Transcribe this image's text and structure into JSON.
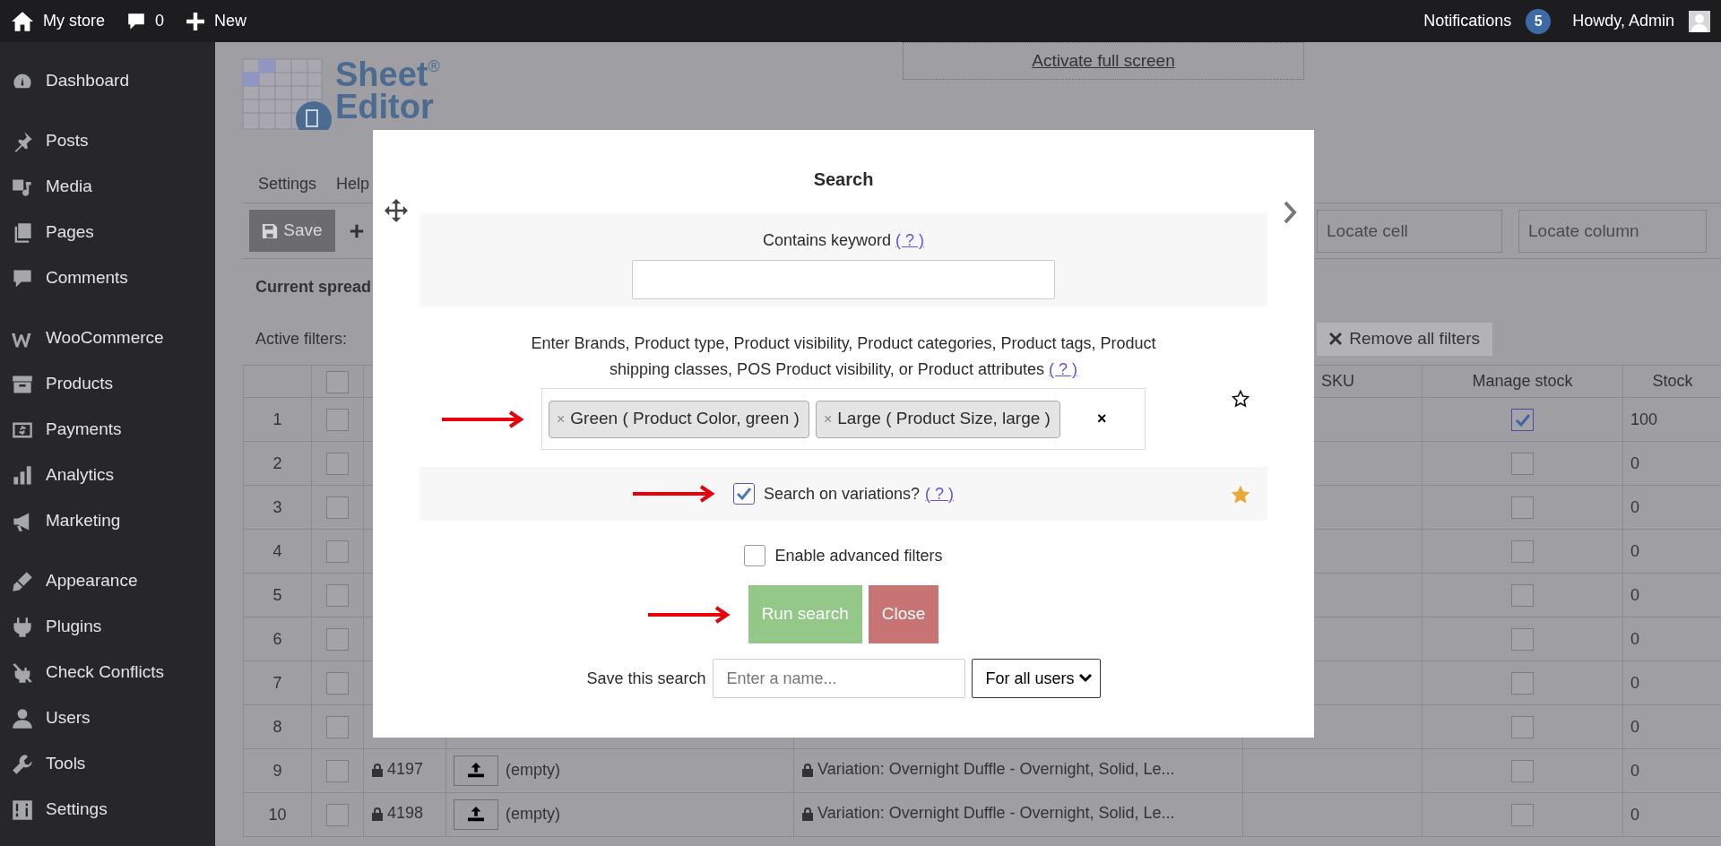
{
  "top_bar": {
    "site": "My store",
    "comments": "0",
    "new": "New",
    "notifications": "Notifications",
    "notifications_count": "5",
    "greeting": "Howdy, Admin"
  },
  "sidebar": {
    "groups": [
      {
        "items": [
          {
            "label": "Dashboard"
          }
        ]
      },
      {
        "items": [
          {
            "label": "Posts"
          },
          {
            "label": "Media"
          },
          {
            "label": "Pages"
          },
          {
            "label": "Comments"
          }
        ]
      },
      {
        "items": [
          {
            "label": "WooCommerce"
          },
          {
            "label": "Products"
          },
          {
            "label": "Payments"
          },
          {
            "label": "Analytics"
          },
          {
            "label": "Marketing"
          }
        ]
      },
      {
        "items": [
          {
            "label": "Appearance"
          },
          {
            "label": "Plugins"
          },
          {
            "label": "Check Conflicts"
          },
          {
            "label": "Users"
          },
          {
            "label": "Tools"
          },
          {
            "label": "Settings"
          }
        ]
      }
    ]
  },
  "editor": {
    "logo": {
      "line_1": "Sheet",
      "line_2": "Editor",
      "mark": "®"
    },
    "fullscreen_link": "Activate full screen",
    "menu": [
      "Settings",
      "Help"
    ],
    "toolbar": {
      "save": "Save",
      "locate_cell_placeholder": "Locate cell",
      "locate_column_placeholder": "Locate column"
    },
    "heading": "Current spread",
    "active_filters_label": "Active filters:",
    "remove_filters": "Remove all filters",
    "table": {
      "header_checkbox": {
        "checked": false
      },
      "columns": [
        "SKU",
        "Manage stock",
        "Stock"
      ],
      "rows": [
        {
          "number": "1",
          "checked": false,
          "manage_stock": true,
          "stock": "100"
        },
        {
          "number": "2",
          "checked": false,
          "manage_stock": false,
          "stock": "0"
        },
        {
          "number": "3",
          "checked": false,
          "manage_stock": false,
          "stock": "0"
        },
        {
          "number": "4",
          "checked": false,
          "manage_stock": false,
          "stock": "0"
        },
        {
          "number": "5",
          "checked": false,
          "manage_stock": false,
          "stock": "0"
        },
        {
          "number": "6",
          "checked": false,
          "manage_stock": false,
          "stock": "0"
        },
        {
          "number": "7",
          "checked": false,
          "manage_stock": false,
          "stock": "0"
        },
        {
          "number": "8",
          "checked": false,
          "manage_stock": false,
          "stock": "0"
        },
        {
          "number": "9",
          "checked": false,
          "id": "4197",
          "image": "(empty)",
          "title": "Variation: Overnight Duffle - Overnight, Solid, Le...",
          "manage_stock": false,
          "stock": "0"
        },
        {
          "number": "10",
          "checked": false,
          "id": "4198",
          "image": "(empty)",
          "title": "Variation: Overnight Duffle - Overnight, Solid, Le...",
          "manage_stock": false,
          "stock": "0"
        }
      ]
    }
  },
  "dialog": {
    "title": "Search",
    "keyword": {
      "label": "Contains keyword",
      "help": "( ? )"
    },
    "taxonomy": {
      "label": "Enter Brands, Product type, Product visibility, Product categories, Product tags, Product shipping classes, POS Product visibility, or Product attributes",
      "help": "( ? )",
      "favorite": false,
      "tokens": [
        {
          "remove": "×",
          "label": "Green ( Product Color, green )"
        },
        {
          "remove": "×",
          "label": "Large ( Product Size, large )"
        }
      ],
      "clear": "×"
    },
    "variations": {
      "label": "Search on variations?",
      "help": "( ? )",
      "checked": true,
      "favorite": true
    },
    "advanced": {
      "label": "Enable advanced filters",
      "checked": false
    },
    "buttons": [
      {
        "kind": "primary",
        "label": "Run search"
      },
      {
        "kind": "cancel",
        "label": "Close"
      }
    ],
    "save": {
      "label": "Save this search",
      "placeholder": "Enter a name...",
      "scope": "For all users"
    }
  }
}
